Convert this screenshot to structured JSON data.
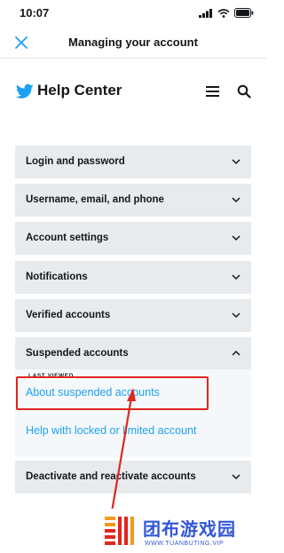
{
  "status_bar": {
    "time": "10:07"
  },
  "nav": {
    "title": "Managing your account"
  },
  "help_center": {
    "title": "Help Center"
  },
  "accordion": [
    {
      "label": "Login and password",
      "expanded": false
    },
    {
      "label": "Username, email, and phone",
      "expanded": false
    },
    {
      "label": "Account settings",
      "expanded": false
    },
    {
      "label": "Notifications",
      "expanded": false
    },
    {
      "label": "Verified accounts",
      "expanded": false
    },
    {
      "label": "Suspended accounts",
      "expanded": true
    },
    {
      "label": "Deactivate and reactivate accounts",
      "expanded": false
    }
  ],
  "suspended_panel": {
    "badge": "LAST VIEWED",
    "links": [
      "About suspended accounts",
      "Help with locked or limited account"
    ]
  },
  "watermark": {
    "text": "团布游戏园",
    "url": "WWW.TUANBUTING.VIP"
  },
  "colors": {
    "link": "#1da1f2",
    "twitter_blue": "#1da1f2",
    "item_bg": "#e8ebee",
    "annotation": "#e0261e",
    "watermark": "#3357d6"
  }
}
